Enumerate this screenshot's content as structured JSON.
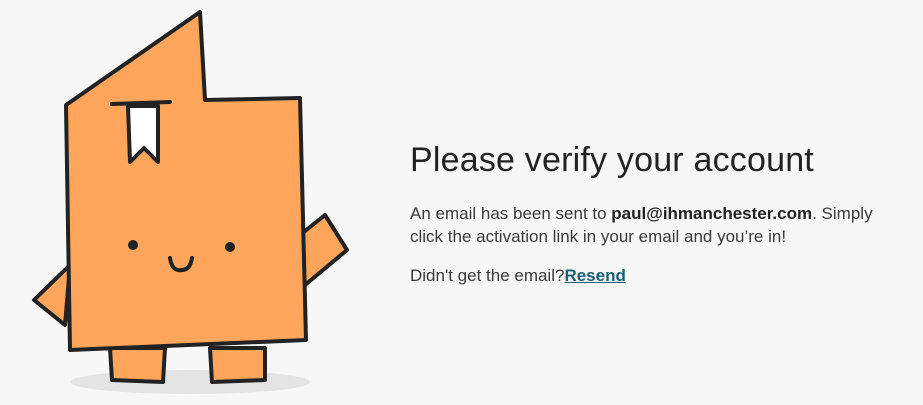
{
  "mascot": {
    "icon": "bookmark-mascot-illustration",
    "body_color": "#ffa65c",
    "outline_color": "#222222",
    "bookmark_color": "#ffffff"
  },
  "verify": {
    "title": "Please verify your account",
    "message_prefix": "An email has been sent to ",
    "email": "paul@ihmanchester.com",
    "message_suffix": ". Simply click the activation link in your email and you’re in!",
    "resend_prompt": "Didn't get the email?",
    "resend_label": "Resend",
    "link_color": "#1b5f77"
  }
}
